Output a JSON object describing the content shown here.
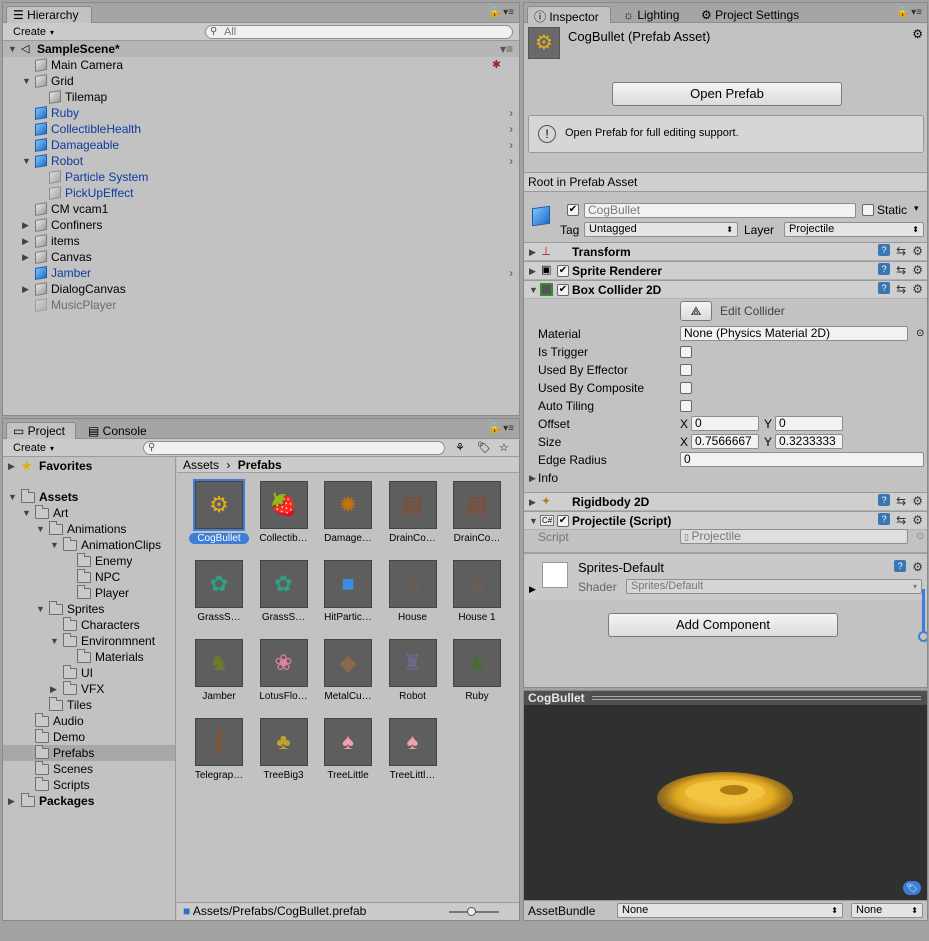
{
  "hierarchy": {
    "tab": "Hierarchy",
    "create": "Create",
    "search_placeholder": "All",
    "scene": "SampleScene*",
    "items": [
      {
        "label": "Main Camera",
        "style": "normal",
        "indent": 1
      },
      {
        "label": "Grid",
        "style": "normal",
        "indent": 1,
        "expanded": true
      },
      {
        "label": "Tilemap",
        "style": "normal",
        "indent": 2
      },
      {
        "label": "Ruby",
        "style": "prefab",
        "indent": 1
      },
      {
        "label": "CollectibleHealth",
        "style": "prefab",
        "indent": 1
      },
      {
        "label": "Damageable",
        "style": "prefab",
        "indent": 1
      },
      {
        "label": "Robot",
        "style": "prefab",
        "indent": 1,
        "expanded": true
      },
      {
        "label": "Particle System",
        "style": "prefab-child",
        "indent": 2
      },
      {
        "label": "PickUpEffect",
        "style": "prefab-child",
        "indent": 2
      },
      {
        "label": "CM vcam1",
        "style": "normal",
        "indent": 1
      },
      {
        "label": "Confiners",
        "style": "normal",
        "indent": 1,
        "collapsed": true
      },
      {
        "label": "items",
        "style": "normal",
        "indent": 1,
        "collapsed": true
      },
      {
        "label": "Canvas",
        "style": "normal",
        "indent": 1,
        "collapsed": true
      },
      {
        "label": "Jamber",
        "style": "prefab",
        "indent": 1
      },
      {
        "label": "DialogCanvas",
        "style": "normal",
        "indent": 1,
        "collapsed": true
      },
      {
        "label": "MusicPlayer",
        "style": "disabled",
        "indent": 1
      }
    ]
  },
  "project": {
    "tab_project": "Project",
    "tab_console": "Console",
    "create": "Create",
    "tree": [
      {
        "label": "Favorites",
        "bold": true,
        "indent": 0,
        "arrow": "right",
        "icon": "star"
      },
      {
        "label": "Assets",
        "bold": true,
        "indent": 0,
        "arrow": "down"
      },
      {
        "label": "Art",
        "indent": 1,
        "arrow": "down"
      },
      {
        "label": "Animations",
        "indent": 2,
        "arrow": "down"
      },
      {
        "label": "AnimationClips",
        "indent": 3,
        "arrow": "down"
      },
      {
        "label": "Enemy",
        "indent": 4
      },
      {
        "label": "NPC",
        "indent": 4
      },
      {
        "label": "Player",
        "indent": 4
      },
      {
        "label": "Sprites",
        "indent": 2,
        "arrow": "down"
      },
      {
        "label": "Characters",
        "indent": 3
      },
      {
        "label": "Environmnent",
        "indent": 3,
        "arrow": "down"
      },
      {
        "label": "Materials",
        "indent": 4
      },
      {
        "label": "UI",
        "indent": 3
      },
      {
        "label": "VFX",
        "indent": 3,
        "arrow": "right"
      },
      {
        "label": "Tiles",
        "indent": 2
      },
      {
        "label": "Audio",
        "indent": 1
      },
      {
        "label": "Demo",
        "indent": 1
      },
      {
        "label": "Prefabs",
        "indent": 1,
        "selected": true
      },
      {
        "label": "Scenes",
        "indent": 1
      },
      {
        "label": "Scripts",
        "indent": 1
      },
      {
        "label": "Packages",
        "bold": true,
        "indent": 0,
        "arrow": "right"
      }
    ],
    "breadcrumb": [
      "Assets",
      "Prefabs"
    ],
    "assets": [
      {
        "name": "CogBullet",
        "glyph": "⚙",
        "color": "#e0b020",
        "selected": true
      },
      {
        "name": "Collectib…",
        "glyph": "🍓",
        "color": "#d02020"
      },
      {
        "name": "Damage…",
        "glyph": "✹",
        "color": "#c07010"
      },
      {
        "name": "DrainCo…",
        "glyph": "▤",
        "color": "#8a4a2a"
      },
      {
        "name": "DrainCo…",
        "glyph": "▤",
        "color": "#8a4a2a"
      },
      {
        "name": "GrassS…",
        "glyph": "✿",
        "color": "#30a080"
      },
      {
        "name": "GrassS…",
        "glyph": "✿",
        "color": "#30a080"
      },
      {
        "name": "HitPartic…",
        "glyph": "■",
        "color": "#3b8de0"
      },
      {
        "name": "House",
        "glyph": "⌂",
        "color": "#8a5a3a"
      },
      {
        "name": "House 1",
        "glyph": "⌂",
        "color": "#8a5a3a"
      },
      {
        "name": "Jamber",
        "glyph": "♞",
        "color": "#6a7a30"
      },
      {
        "name": "LotusFlo…",
        "glyph": "❀",
        "color": "#e080a0"
      },
      {
        "name": "MetalCu…",
        "glyph": "◆",
        "color": "#8a6a4a"
      },
      {
        "name": "Robot",
        "glyph": "♜",
        "color": "#6a6a8a"
      },
      {
        "name": "Ruby",
        "glyph": "♟",
        "color": "#4a6a3a"
      },
      {
        "name": "Telegrap…",
        "glyph": "┃",
        "color": "#8a5030"
      },
      {
        "name": "TreeBig3",
        "glyph": "♣",
        "color": "#c0a030"
      },
      {
        "name": "TreeLittle",
        "glyph": "♠",
        "color": "#f0a0b0"
      },
      {
        "name": "TreeLittl…",
        "glyph": "♠",
        "color": "#f0a0b0"
      }
    ],
    "status_path": "Assets/Prefabs/CogBullet.prefab"
  },
  "inspector": {
    "tabs": [
      "Inspector",
      "Lighting",
      "Project Settings"
    ],
    "asset_title": "CogBullet (Prefab Asset)",
    "open_prefab": "Open Prefab",
    "info_msg": "Open Prefab for full editing support.",
    "root_label": "Root in Prefab Asset",
    "object_name": "CogBullet",
    "static_label": "Static",
    "tag_label": "Tag",
    "tag_value": "Untagged",
    "layer_label": "Layer",
    "layer_value": "Projectile",
    "components": {
      "transform": "Transform",
      "sprite_renderer": "Sprite Renderer",
      "box_collider": "Box Collider 2D",
      "rigidbody": "Rigidbody 2D",
      "projectile": "Projectile (Script)"
    },
    "edit_collider": "Edit Collider",
    "props": {
      "material_label": "Material",
      "material_value": "None (Physics Material 2D)",
      "is_trigger": "Is Trigger",
      "used_by_effector": "Used By Effector",
      "used_by_composite": "Used By Composite",
      "auto_tiling": "Auto Tiling",
      "offset_label": "Offset",
      "offset_x": "0",
      "offset_y": "0",
      "size_label": "Size",
      "size_x": "0.7566667",
      "size_y": "0.3233333",
      "edge_radius_label": "Edge Radius",
      "edge_radius_value": "0",
      "info_label": "Info",
      "x": "X",
      "y": "Y"
    },
    "script_label": "Script",
    "script_value": "Projectile",
    "material_name": "Sprites-Default",
    "shader_label": "Shader",
    "shader_value": "Sprites/Default",
    "add_component": "Add Component",
    "preview_title": "CogBullet",
    "assetbundle_label": "AssetBundle",
    "assetbundle_value": "None",
    "assetbundle_variant": "None"
  }
}
